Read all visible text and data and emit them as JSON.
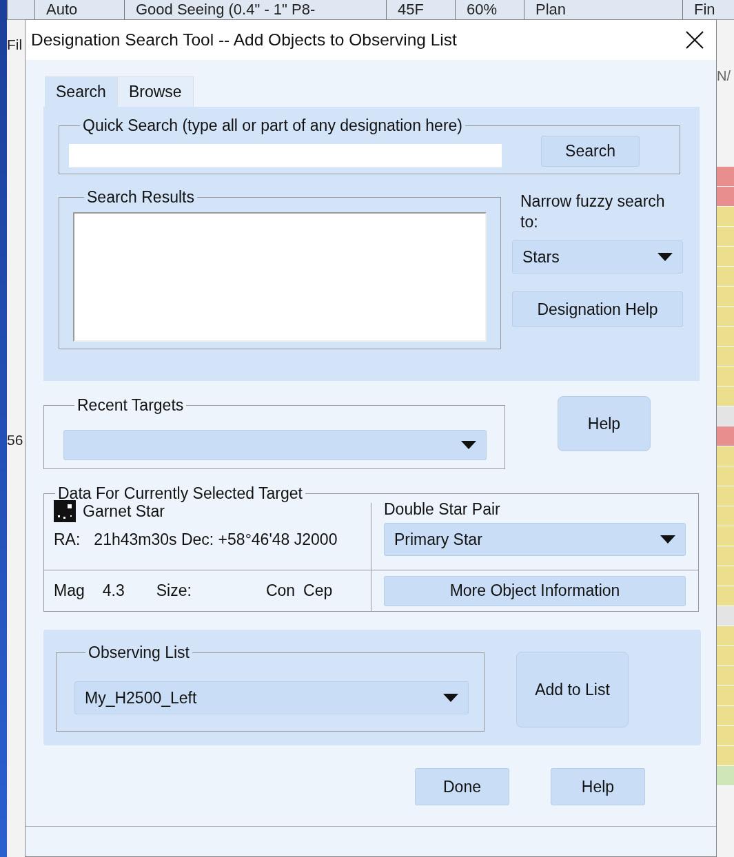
{
  "background_app": {
    "toolbar": [
      "Auto",
      "Good Seeing (0.4\" - 1\" P8-",
      "45F",
      "60%",
      "Plan",
      "Fin"
    ],
    "left_labels": [
      "Fil",
      "56"
    ],
    "right_label": "N/",
    "status_rows": [
      {
        "color": "#e98e8e"
      },
      {
        "color": "#e98e8e"
      },
      {
        "color": "#ebdf8e"
      },
      {
        "color": "#ebdf8e"
      },
      {
        "color": "#ebdf8e"
      },
      {
        "color": "#ebdf8e"
      },
      {
        "color": "#ebdf8e"
      },
      {
        "color": "#ebdf8e"
      },
      {
        "color": "#ebdf8e"
      },
      {
        "color": "#ebdf8e"
      },
      {
        "color": "#ebdf8e"
      },
      {
        "color": "#ebdf8e"
      },
      {
        "color": "#e4e4e4"
      },
      {
        "color": "#e98e8e"
      },
      {
        "color": "#ebdf8e"
      },
      {
        "color": "#ebdf8e"
      },
      {
        "color": "#ebdf8e"
      },
      {
        "color": "#ebdf8e"
      },
      {
        "color": "#ebdf8e"
      },
      {
        "color": "#ebdf8e"
      },
      {
        "color": "#ebdf8e"
      },
      {
        "color": "#ebdf8e"
      },
      {
        "color": "#e4e4e4"
      },
      {
        "color": "#ebdf8e"
      },
      {
        "color": "#ebdf8e"
      },
      {
        "color": "#ebdf8e"
      },
      {
        "color": "#ebdf8e"
      },
      {
        "color": "#ebdf8e"
      },
      {
        "color": "#ebdf8e"
      },
      {
        "color": "#ebdf8e"
      },
      {
        "color": "#cfe6b8"
      }
    ]
  },
  "dialog": {
    "title": "Designation Search Tool -- Add Objects to Observing List",
    "tabs": [
      {
        "label": "Search",
        "selected": true
      },
      {
        "label": "Browse",
        "selected": false
      }
    ],
    "quick_search": {
      "legend": "Quick Search (type all or part of any designation here)",
      "button": "Search"
    },
    "search_results": {
      "legend": "Search Results"
    },
    "narrow": {
      "label": "Narrow fuzzy search to:",
      "value": "Stars"
    },
    "designation_help": "Designation Help",
    "recent_targets": {
      "legend": "Recent Targets"
    },
    "help_top": "Help",
    "target_data": {
      "legend": "Data For Currently Selected Target",
      "name": "Garnet Star",
      "ra_label": "RA:",
      "ra_value": "21h43m30s Dec: +58°46'48 J2000",
      "mag_label": "Mag",
      "mag_value": "4.3",
      "size_label": "Size:",
      "con_label": "Con",
      "con_value": "Cep",
      "pair_label": "Double Star Pair",
      "pair_value": "Primary Star",
      "more_button": "More Object Information"
    },
    "observing_list": {
      "legend": "Observing List",
      "value": "My_H2500_Left",
      "add_button": "Add to List"
    },
    "footer_buttons": [
      "Done",
      "Help"
    ]
  }
}
